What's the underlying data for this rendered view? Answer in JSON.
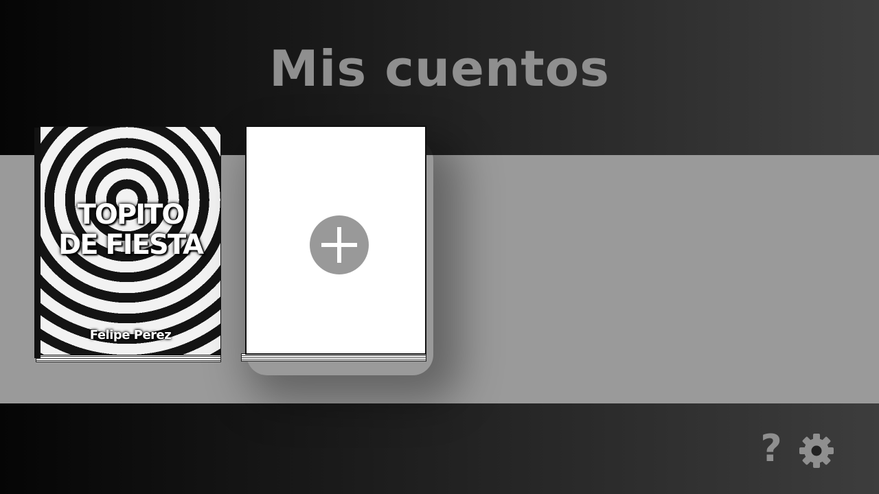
{
  "header": {
    "title": "Mis cuentos"
  },
  "books": [
    {
      "title": "TOPITO\nDE FIESTA",
      "author": "Felipe Perez"
    }
  ],
  "new_book": {
    "icon": "plus-icon"
  },
  "footer": {
    "help_icon": "question-icon",
    "help_glyph": "?",
    "settings_icon": "gear-icon"
  },
  "colors": {
    "shelf": "#9a9a9a",
    "title_text": "#8f8f8f",
    "add_button": "#999999"
  }
}
